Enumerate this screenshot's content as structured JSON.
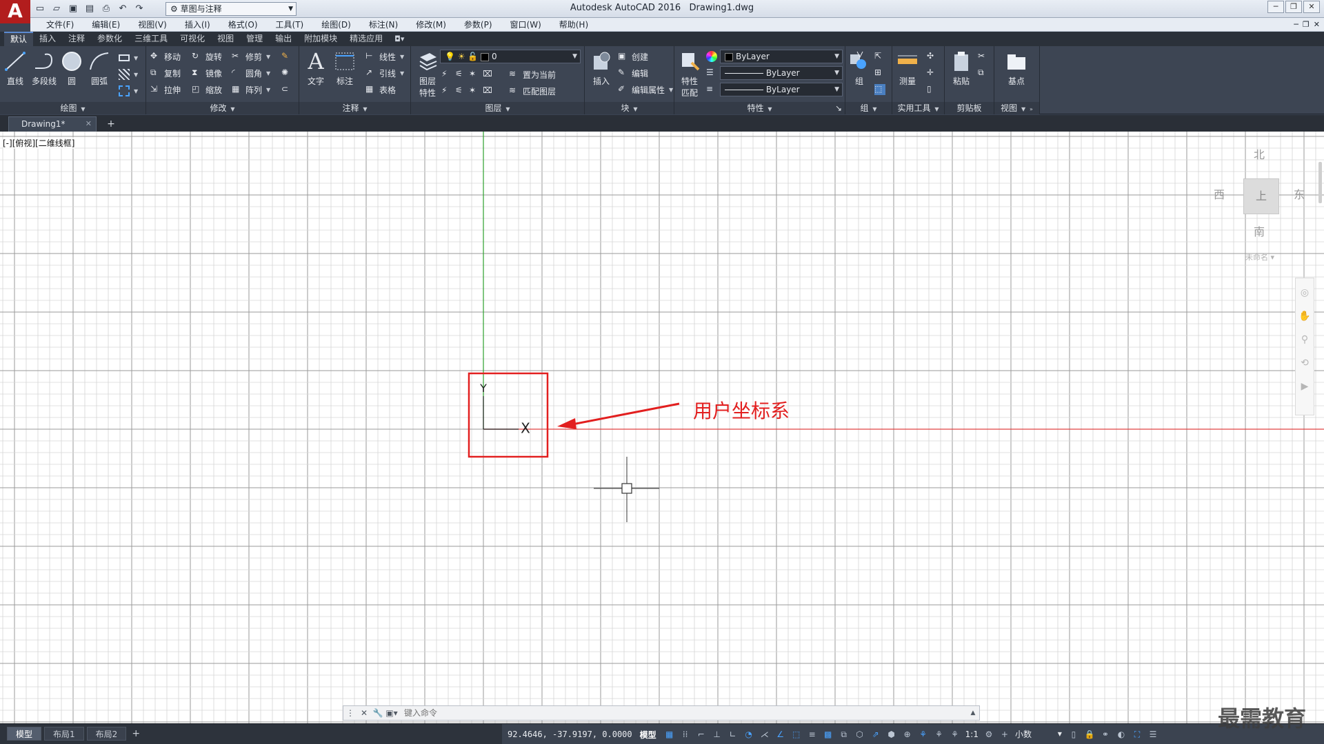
{
  "window": {
    "app_title": "Autodesk AutoCAD 2016",
    "file_name": "Drawing1.dwg",
    "workspace": "草图与注释",
    "logo": "A"
  },
  "menu": [
    "文件(F)",
    "编辑(E)",
    "视图(V)",
    "插入(I)",
    "格式(O)",
    "工具(T)",
    "绘图(D)",
    "标注(N)",
    "修改(M)",
    "参数(P)",
    "窗口(W)",
    "帮助(H)"
  ],
  "ribbon_tabs": [
    "默认",
    "插入",
    "注释",
    "参数化",
    "三维工具",
    "可视化",
    "视图",
    "管理",
    "输出",
    "附加模块",
    "精选应用"
  ],
  "ribbon": {
    "draw": {
      "title": "绘图",
      "line": "直线",
      "polyline": "多段线",
      "circle": "圆",
      "arc": "圆弧"
    },
    "modify": {
      "title": "修改",
      "move": "移动",
      "rotate": "旋转",
      "trim": "修剪",
      "copy": "复制",
      "mirror": "镜像",
      "fillet": "圆角",
      "stretch": "拉伸",
      "scale": "缩放",
      "array": "阵列"
    },
    "annotation": {
      "title": "注释",
      "text": "文字",
      "dimension": "标注",
      "linear": "线性",
      "leader": "引线",
      "table": "表格"
    },
    "layers": {
      "title": "图层",
      "layer_props_1": "图层",
      "layer_props_2": "特性",
      "current_layer": "0",
      "set_current": "置为当前",
      "match_layer": "匹配图层"
    },
    "block": {
      "title": "块",
      "insert": "插入",
      "create": "创建",
      "edit": "编辑",
      "edit_attr": "编辑属性"
    },
    "properties": {
      "title": "特性",
      "match_1": "特性",
      "match_2": "匹配",
      "color": "ByLayer",
      "linetype": "ByLayer",
      "lineweight": "ByLayer"
    },
    "groups": {
      "title": "组",
      "group": "组"
    },
    "utilities": {
      "title": "实用工具",
      "measure": "测量"
    },
    "clipboard": {
      "title": "剪贴板",
      "paste": "粘贴"
    },
    "view": {
      "title": "视图",
      "base": "基点"
    }
  },
  "doc_tab": "Drawing1*",
  "viewport_label": "[-][俯视][二维线框]",
  "viewcube": {
    "north": "北",
    "south": "南",
    "east": "东",
    "west": "西",
    "face": "上",
    "wcs": "未命名"
  },
  "annotation": {
    "label": "用户坐标系",
    "ucs_y": "Y",
    "ucs_x": "X"
  },
  "command_placeholder": "键入命令",
  "layout_tabs": [
    "模型",
    "布局1",
    "布局2"
  ],
  "status": {
    "coords": "92.4646, -37.9197, 0.0000",
    "model": "模型",
    "scale": "1:1",
    "units": "小数"
  },
  "watermark": "最需教育",
  "colors": {
    "accent_red": "#e21f1f",
    "ucs_y_axis": "#2ca02c",
    "x_axis": "#e04040",
    "grid_major": "#9a9a9a",
    "grid_minor": "#d6d6d6"
  }
}
